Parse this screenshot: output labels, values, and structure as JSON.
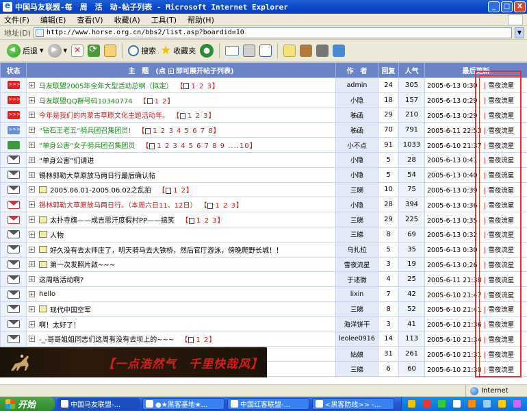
{
  "window": {
    "title": "中国马友联盟-每　周　活　动-帖子列表 - Microsoft Internet Explorer",
    "min_label": "_",
    "max_label": "□",
    "close_label": "X"
  },
  "menu": [
    "文件(F)",
    "编辑(E)",
    "查看(V)",
    "收藏(A)",
    "工具(T)",
    "帮助(H)"
  ],
  "address": {
    "label": "地址(D)",
    "url": "http://www.horse.org.cn/bbs2/list.asp?boardid=10"
  },
  "toolbar": {
    "back_label": "后退",
    "search_label": "搜索",
    "favorites_label": "收藏夹"
  },
  "table": {
    "headers": {
      "status": "状态",
      "topic": "主　题　(点",
      "topic_suffix": "即可展开帖子列表)",
      "author": "作　者",
      "replies": "回复",
      "views": "人气",
      "last": "最后更新"
    },
    "rows": [
      {
        "icon": "hot",
        "topic": "马友联盟2005年全年大型活动总纲（拟定）",
        "color": "green",
        "pages": "1 2 3",
        "img": false,
        "author": "admin",
        "replies": "24",
        "views": "305",
        "date": "2005-6-13 0:30",
        "last_user": "雪夜流星"
      },
      {
        "icon": "hot",
        "topic": "马友联盟QQ群号码10340774",
        "color": "green",
        "pages": "1 2",
        "img": false,
        "author": "小隐",
        "replies": "18",
        "views": "157",
        "date": "2005-6-13 0:29",
        "last_user": "雪夜流星"
      },
      {
        "icon": "hot",
        "topic": "今年是我们的内蒙古草原文化主题活动年。",
        "color": "red",
        "pages": "1 2 3",
        "img": false,
        "author": "秭函",
        "replies": "29",
        "views": "210",
        "date": "2005-6-13 0:29",
        "last_user": "雪夜流星"
      },
      {
        "icon": "lock",
        "topic": "“钻石王老五”骑兵团召集团员!",
        "color": "green",
        "pages": "1 2 3 4 5 6 7 8",
        "img": false,
        "author": "秭函",
        "replies": "70",
        "views": "791",
        "date": "2005-6-11 22:53",
        "last_user": "雪夜流星"
      },
      {
        "icon": "grow",
        "topic": "“单身公害”女子骑兵团召集团员",
        "color": "green",
        "pages": "1 2 3 4 5 6 7 8 9 ....10",
        "img": false,
        "author": "小不点",
        "replies": "91",
        "views": "1033",
        "date": "2005-6-10 21:37",
        "last_user": "雪夜流星"
      },
      {
        "icon": "env",
        "topic": "“单身公害”们请进",
        "color": "black",
        "pages": "",
        "img": false,
        "author": "小隐",
        "replies": "5",
        "views": "28",
        "date": "2005-6-13 0:41",
        "last_user": "雪夜流星"
      },
      {
        "icon": "env",
        "topic": "锡林郭勒大草原放马两日行最后确认帖",
        "color": "black",
        "pages": "",
        "img": false,
        "author": "小隐",
        "replies": "5",
        "views": "54",
        "date": "2005-6-13 0:40",
        "last_user": "雪夜流星"
      },
      {
        "icon": "env",
        "topic": "2005.06.01-2005.06.02之乱拍",
        "color": "black",
        "pages": "1 2",
        "img": true,
        "author": "三睇",
        "replies": "10",
        "views": "75",
        "date": "2005-6-13 0:39",
        "last_user": "雪夜流星"
      },
      {
        "icon": "envhot",
        "topic": "锡林郭勒大草原放马两日行。（本周六日11、12日）",
        "color": "red",
        "pages": "1 2 3",
        "img": false,
        "author": "小隐",
        "replies": "28",
        "views": "394",
        "date": "2005-6-13 0:36",
        "last_user": "雪夜流星"
      },
      {
        "icon": "envhot",
        "topic": "太扑寺旗——成吉思汗度假村PP——搞笑",
        "color": "black",
        "pages": "1 2 3",
        "img": true,
        "author": "三睇",
        "replies": "29",
        "views": "225",
        "date": "2005-6-13 0:35",
        "last_user": "雪夜流星"
      },
      {
        "icon": "env",
        "topic": "人物",
        "color": "black",
        "pages": "",
        "img": true,
        "author": "三睇",
        "replies": "8",
        "views": "69",
        "date": "2005-6-13 0:32",
        "last_user": "雪夜流星"
      },
      {
        "icon": "env",
        "topic": "好久没有去太师庄了，明天骑马去大铁桥，然后官厅游泳，傍晚爬野长城！！",
        "color": "black",
        "pages": "",
        "img": true,
        "author": "乌扎拉",
        "replies": "5",
        "views": "35",
        "date": "2005-6-13 0:30",
        "last_user": "雪夜流星"
      },
      {
        "icon": "env",
        "topic": "第一次发照片啟~~~",
        "color": "black",
        "pages": "",
        "img": true,
        "author": "雪夜流星",
        "replies": "3",
        "views": "19",
        "date": "2005-6-13 0:26",
        "last_user": "雪夜流星"
      },
      {
        "icon": "env",
        "topic": "这周啥活动啊?",
        "color": "black",
        "pages": "",
        "img": false,
        "author": "于述微",
        "replies": "4",
        "views": "25",
        "date": "2005-6-11 21:38",
        "last_user": "雪夜流星"
      },
      {
        "icon": "env",
        "topic": "hello",
        "color": "black",
        "pages": "",
        "img": false,
        "author": "lixin",
        "replies": "7",
        "views": "42",
        "date": "2005-6-10 21:47",
        "last_user": "雪夜流星"
      },
      {
        "icon": "env",
        "topic": "现代中国空军",
        "color": "black",
        "pages": "",
        "img": true,
        "author": "三睇",
        "replies": "8",
        "views": "52",
        "date": "2005-6-10 21:41",
        "last_user": "雪夜流星"
      },
      {
        "icon": "env",
        "topic": "啊！太好了！",
        "color": "black",
        "pages": "",
        "img": false,
        "author": "海洋饼干",
        "replies": "3",
        "views": "41",
        "date": "2005-6-10 21:36",
        "last_user": "雪夜流星"
      },
      {
        "icon": "env",
        "topic": "-_-哥哥姐姐同志们这周有没有去坝上的~~~",
        "color": "black",
        "pages": "1 2",
        "img": false,
        "author": "leolee0916",
        "replies": "14",
        "views": "113",
        "date": "2005-6-10 21:34",
        "last_user": "雪夜流星"
      },
      {
        "icon": "env",
        "topic": "",
        "color": "black",
        "pages": "",
        "img": false,
        "author": "姑娘",
        "replies": "31",
        "views": "261",
        "date": "2005-6-10 21:31",
        "last_user": "雪夜流星"
      },
      {
        "icon": "env",
        "topic": "",
        "color": "black",
        "pages": "",
        "img": false,
        "author": "三睇",
        "replies": "6",
        "views": "60",
        "date": "2005-6-10 21:30",
        "last_user": "雪夜流星"
      }
    ]
  },
  "banner": {
    "slogan": "【一点浩然气　千里快哉风】"
  },
  "statusbar": {
    "left": "",
    "zone": "Internet"
  },
  "taskbar": {
    "start": "开始",
    "tasks": [
      "中国马友联盟-...",
      "●★黑客基地★...",
      "中国红客联盟-...",
      "<黑客防线>> -..."
    ]
  }
}
